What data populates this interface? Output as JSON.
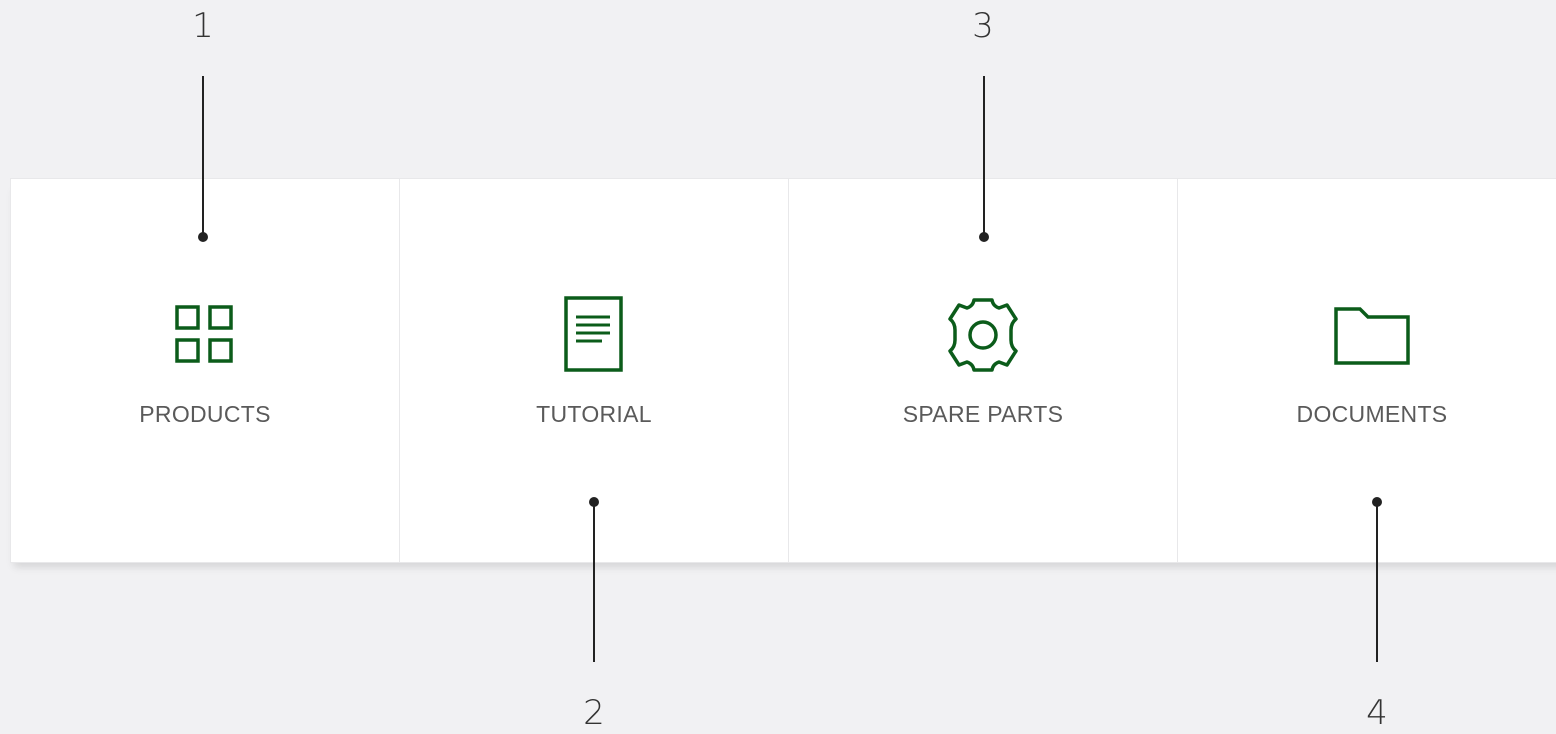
{
  "cards": [
    {
      "label": "PRODUCTS",
      "icon": "grid-icon"
    },
    {
      "label": "TUTORIAL",
      "icon": "document-icon"
    },
    {
      "label": "SPARE PARTS",
      "icon": "gear-icon"
    },
    {
      "label": "DOCUMENTS",
      "icon": "folder-icon"
    }
  ],
  "callouts": [
    "1",
    "2",
    "3",
    "4"
  ],
  "colors": {
    "icon": "#0b5c1a",
    "label": "#5a5a5a",
    "background": "#f1f1f3",
    "callout": "#222222"
  }
}
